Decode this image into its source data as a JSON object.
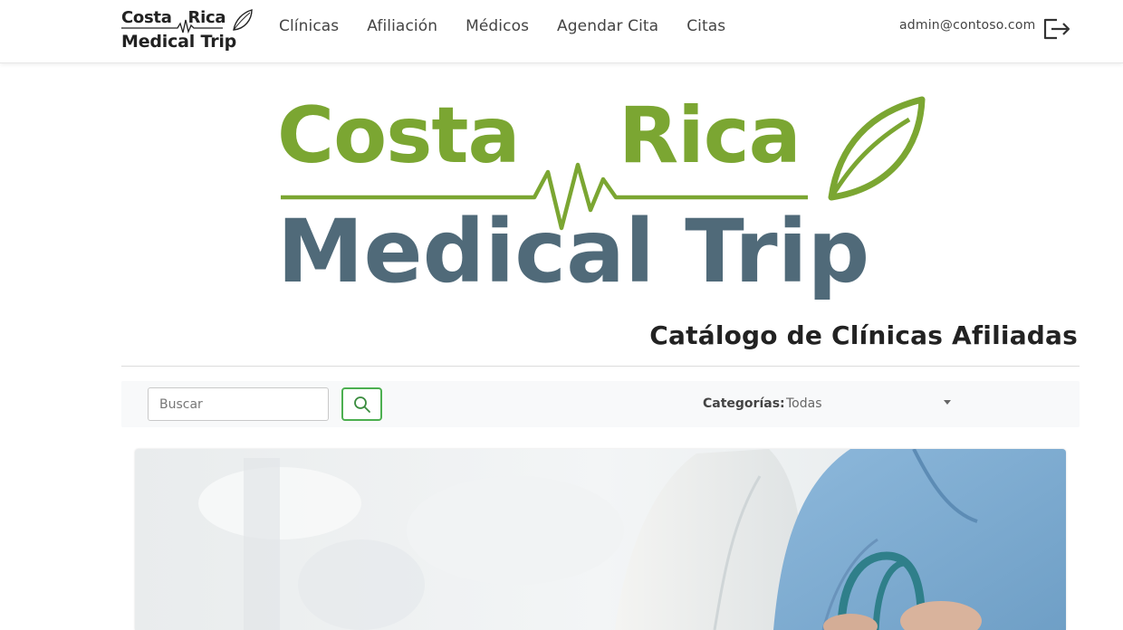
{
  "brand": {
    "line1_left": "Costa",
    "line1_right": "Rica",
    "line2": "Medical Trip"
  },
  "nav": {
    "links": [
      "Clínicas",
      "Afiliación",
      "Médicos",
      "Agendar Cita",
      "Citas"
    ]
  },
  "user": {
    "email": "admin@contoso.com"
  },
  "hero": {
    "word1": "Costa",
    "word2": "Rica",
    "line2": "Medical Trip"
  },
  "page": {
    "title": "Catálogo de Clínicas Afiliadas"
  },
  "filters": {
    "search_placeholder": "Buscar",
    "category_label": "Categorías:",
    "category_value": "Todas"
  },
  "icons": {
    "search": "search-icon",
    "logout": "logout-icon",
    "leaf": "leaf-icon",
    "dropdown": "chevron-down-icon"
  },
  "colors": {
    "brand_green": "#7ba632",
    "brand_slate": "#506a79",
    "button_green": "#4caf50"
  }
}
